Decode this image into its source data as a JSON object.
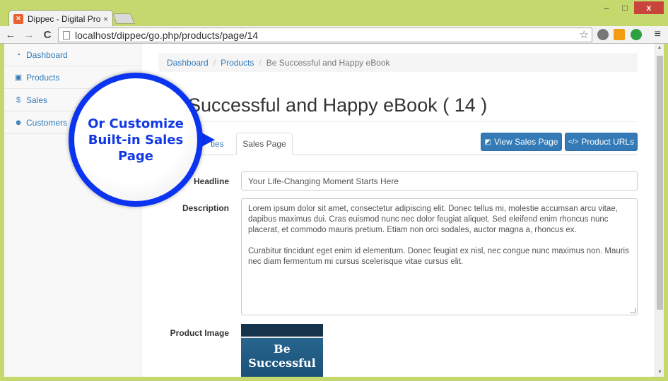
{
  "browser": {
    "tab_title": "Dippec - Digital Product M",
    "tab_close": "×",
    "url": "localhost/dippec/go.php/products/page/14",
    "back": "←",
    "forward": "→",
    "reload": "C",
    "star": "☆",
    "menu": "≡",
    "minimize": "–",
    "maximize": "□",
    "close": "x"
  },
  "sidebar": {
    "items": [
      {
        "label": "Dashboard",
        "icon": "dashboard-icon",
        "glyph": "◔"
      },
      {
        "label": "Products",
        "icon": "gift-icon",
        "glyph": "▣"
      },
      {
        "label": "Sales",
        "icon": "dollar-icon",
        "glyph": "$"
      },
      {
        "label": "Customers",
        "icon": "users-icon",
        "glyph": "☻"
      }
    ]
  },
  "breadcrumb": {
    "items": [
      "Dashboard",
      "Products"
    ],
    "separator": "/",
    "active": "Be Successful and Happy eBook"
  },
  "page": {
    "title": "Successful and Happy eBook ( 14 )"
  },
  "tabs": {
    "inactive_partial": "ties",
    "active": "Sales Page"
  },
  "buttons": {
    "view_sales_page": "View Sales Page",
    "product_urls": "Product URLs"
  },
  "form": {
    "headline_label": "Headline",
    "headline_value": "Your Life-Changing Moment Starts Here",
    "description_label": "Description",
    "description_p1": "Lorem ipsum dolor sit amet, consectetur adipiscing elit. Donec tellus mi, molestie accumsan arcu vitae, dapibus maximus dui. Cras euismod nunc nec dolor feugiat aliquet. Sed eleifend enim rhoncus nunc placerat, et commodo mauris pretium. Etiam non orci sodales, auctor magna a, rhoncus ex.",
    "description_p2": "Curabitur tincidunt eget enim id elementum. Donec feugiat ex nisl, nec congue nunc maximus non. Mauris nec diam fermentum mi cursus scelerisque vitae cursus elit.",
    "product_image_label": "Product Image",
    "product_image_text": "Be Successful"
  },
  "callout": {
    "text": "Or Customize Built-in Sales Page"
  },
  "colors": {
    "link": "#337ab7",
    "callout": "#0b34f0"
  }
}
